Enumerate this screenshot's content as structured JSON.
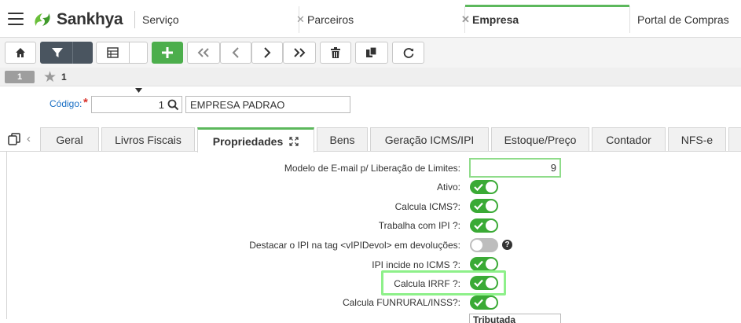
{
  "app": {
    "logo_text": "Sankhya"
  },
  "top_tabs": [
    {
      "label": "Serviço"
    },
    {
      "label": "Parceiros"
    },
    {
      "label": "Empresa"
    },
    {
      "label": "Portal de Compras"
    }
  ],
  "record_nav": {
    "page": "1",
    "count": "1"
  },
  "form": {
    "codigo_label": "Código:",
    "required_mark": "*",
    "codigo_value": "1",
    "nome_value": "EMPRESA PADRAO"
  },
  "content_tabs": [
    {
      "label": "Geral"
    },
    {
      "label": "Livros Fiscais"
    },
    {
      "label": "Propriedades"
    },
    {
      "label": "Bens"
    },
    {
      "label": "Geração ICMS/IPI"
    },
    {
      "label": "Estoque/Preço"
    },
    {
      "label": "Contador"
    },
    {
      "label": "NFS-e"
    }
  ],
  "properties": {
    "modelo_email_label": "Modelo de E-mail p/ Liberação de Limites:",
    "modelo_email_value": "9",
    "ativo_label": "Ativo:",
    "ativo_on": true,
    "calcula_icms_label": "Calcula ICMS?:",
    "calcula_icms_on": true,
    "trabalha_ipi_label": "Trabalha com IPI ?:",
    "trabalha_ipi_on": true,
    "destacar_ipi_label": "Destacar o IPI na tag <vIPIDevol> em devoluções:",
    "destacar_ipi_on": false,
    "ipi_incide_label": "IPI incide no ICMS ?:",
    "ipi_incide_on": true,
    "calcula_irrf_label": "Calcula IRRF ?:",
    "calcula_irrf_on": true,
    "calcula_funrural_label": "Calcula FUNRURAL/INSS?:",
    "calcula_funrural_on": true,
    "iss_value": "Tributada"
  },
  "colors": {
    "accent_green": "#5cb85c",
    "toggle_on": "#3aaa35",
    "link_blue": "#1a6fc4"
  }
}
